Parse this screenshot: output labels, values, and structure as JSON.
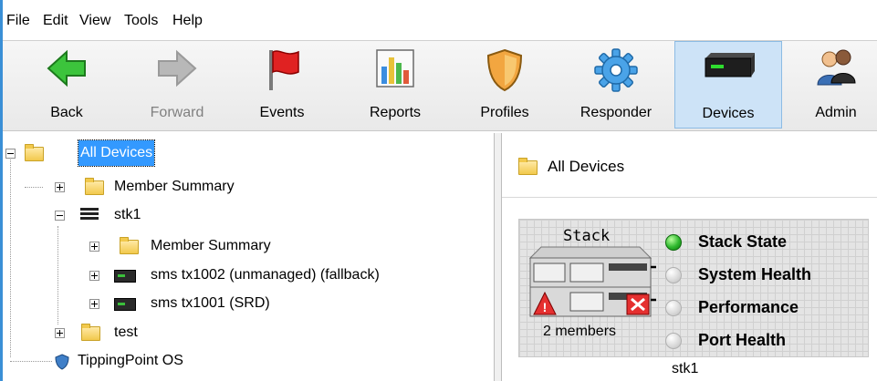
{
  "menu": [
    "File",
    "Edit",
    "View",
    "Tools",
    "Help"
  ],
  "toolbar": {
    "back": "Back",
    "forward": "Forward",
    "events": "Events",
    "reports": "Reports",
    "profiles": "Profiles",
    "responder": "Responder",
    "devices": "Devices",
    "admin": "Admin"
  },
  "tree": {
    "all_devices": "All Devices",
    "member_summary": "Member Summary",
    "stk1": "stk1",
    "stk1_member_summary": "Member Summary",
    "sms1002": "sms tx1002 (unmanaged) (fallback)",
    "sms1001": "sms tx1001 (SRD)",
    "test": "test",
    "tippingpoint_os": "TippingPoint OS"
  },
  "detail": {
    "header": "All Devices",
    "stack_title": "Stack",
    "members": "2 members",
    "statuses": [
      "Stack State",
      "System Health",
      "Performance",
      "Port Health"
    ],
    "caption": "stk1"
  },
  "colors": {
    "selection": "#3399ff",
    "status_ok": "#2eb82e",
    "status_off": "#d8d8d8",
    "active_button": "#cde3f7"
  },
  "icons": {
    "back": "green-left-arrow-icon",
    "forward": "gray-right-arrow-icon",
    "events": "red-flag-icon",
    "reports": "bar-chart-icon",
    "profiles": "shield-icon",
    "responder": "blue-gear-icon",
    "devices": "network-device-icon",
    "admin": "users-icon"
  }
}
